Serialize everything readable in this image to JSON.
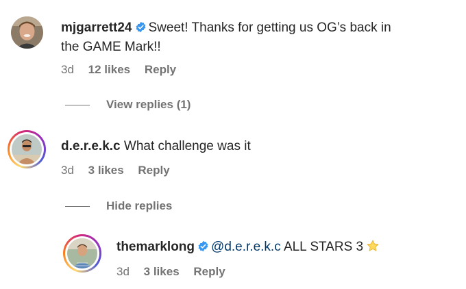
{
  "colors": {
    "verified": "#3897f0",
    "meta": "#737373",
    "mention": "#00376b"
  },
  "comments": [
    {
      "username": "mjgarrett24",
      "verified": true,
      "text_line1": "Sweet! Thanks for getting us OG’s back in",
      "text_line2": "the GAME Mark!!",
      "time": "3d",
      "likes": "12 likes",
      "reply": "Reply",
      "toggle": "View replies (1)"
    },
    {
      "username": "d.e.r.e.k.c",
      "verified": false,
      "text": "What challenge was it",
      "time": "3d",
      "likes": "3 likes",
      "reply": "Reply",
      "toggle": "Hide replies"
    }
  ],
  "reply": {
    "username": "themarklong",
    "verified": true,
    "mention": "@d.e.r.e.k.c",
    "text": "ALL STARS 3",
    "emoji": "star-icon",
    "time": "3d",
    "likes": "3 likes",
    "reply": "Reply"
  }
}
